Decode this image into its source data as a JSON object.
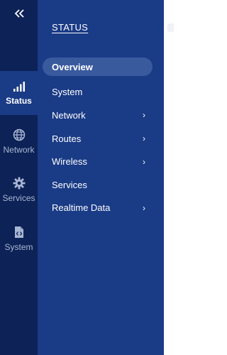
{
  "rail": {
    "collapse_label": "«",
    "items": [
      {
        "label": "Status",
        "icon": "signal-bars-icon",
        "active": true
      },
      {
        "label": "Network",
        "icon": "globe-icon",
        "active": false
      },
      {
        "label": "Services",
        "icon": "gear-icon",
        "active": false
      },
      {
        "label": "System",
        "icon": "code-file-icon",
        "active": false
      }
    ]
  },
  "menu": {
    "title": "STATUS",
    "items": [
      {
        "label": "Overview",
        "active": true,
        "has_submenu": false
      },
      {
        "label": "System",
        "active": false,
        "has_submenu": false
      },
      {
        "label": "Network",
        "active": false,
        "has_submenu": true
      },
      {
        "label": "Routes",
        "active": false,
        "has_submenu": true
      },
      {
        "label": "Wireless",
        "active": false,
        "has_submenu": true
      },
      {
        "label": "Services",
        "active": false,
        "has_submenu": false
      },
      {
        "label": "Realtime Data",
        "active": false,
        "has_submenu": true
      }
    ],
    "chevron": "›"
  },
  "colors": {
    "rail_bg": "#0d2257",
    "menu_bg": "#1a3b86",
    "active_pill": "#3a5a9e",
    "text": "#ffffff",
    "muted_text": "#a9b6d3"
  }
}
